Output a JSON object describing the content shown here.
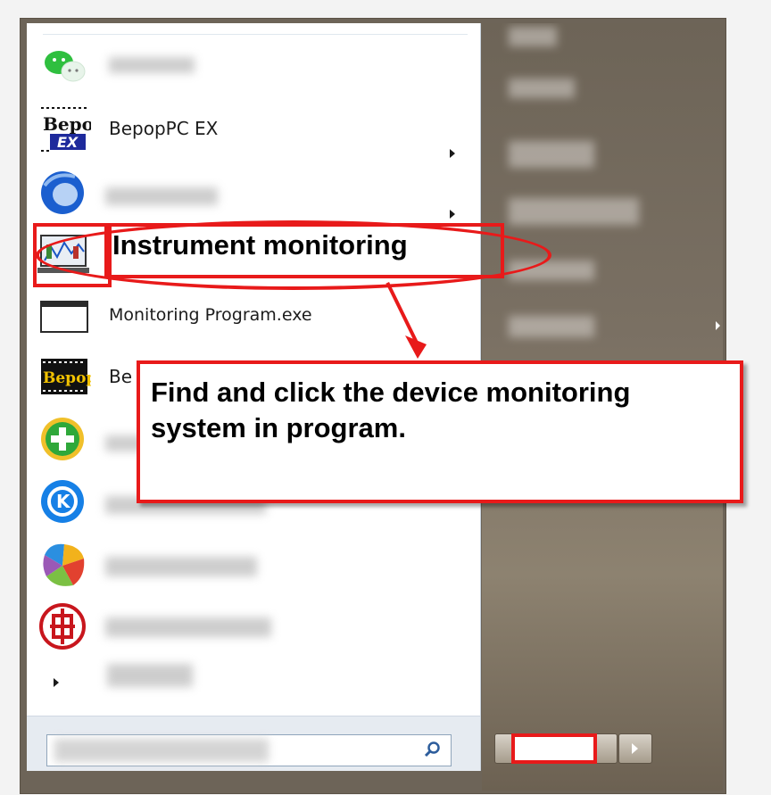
{
  "start_menu": {
    "pinned_items": [
      {
        "icon": "wechat-icon",
        "label": "",
        "has_submenu": false
      },
      {
        "icon": "bepop-ex-icon",
        "label": "BepopPC EX",
        "has_submenu": true
      },
      {
        "icon": "blue-sphere-icon",
        "label": "",
        "has_submenu": true
      },
      {
        "icon": "monitor-chart-icon",
        "label": "",
        "has_submenu": false
      },
      {
        "icon": "window-icon",
        "label": "Monitoring Program.exe",
        "has_submenu": false
      },
      {
        "icon": "bepop-icon",
        "label": "Be",
        "has_submenu": false
      },
      {
        "icon": "green-plus-icon",
        "label": "",
        "has_submenu": false
      },
      {
        "icon": "k-circle-icon",
        "label": "",
        "has_submenu": true
      },
      {
        "icon": "colorful-petal-icon",
        "label": "",
        "has_submenu": false
      },
      {
        "icon": "red-seal-icon",
        "label": "",
        "has_submenu": false
      }
    ],
    "search": {
      "placeholder": ""
    }
  },
  "annotations": {
    "highlight_label": "Instrument monitoring",
    "tip": "Find and click the device monitoring system in program.",
    "highlight_color": "#e81a1a"
  },
  "colors": {
    "right_pane": "#7a7063",
    "menu_bg": "#ffffff"
  }
}
